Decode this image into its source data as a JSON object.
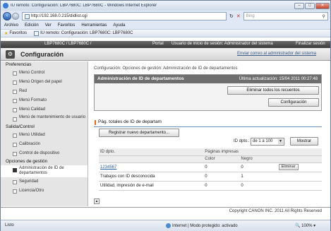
{
  "browser": {
    "title": "IU remoto: Configuración: LBP7680C: LBP7680C - Windows Internet Explorer",
    "address": "http://192.168.0.215/didlist.cgi",
    "search_placeholder": "Bing",
    "menu": [
      "Archivo",
      "Edición",
      "Ver",
      "Favoritos",
      "Herramientas",
      "Ayuda"
    ],
    "favorites_label": "Favoritos",
    "tab_title": "IU remoto: Configuración: LBP7680C: LBP7680C",
    "status_text": "Listo",
    "zone_text": "Internet | Modo protegido: activado",
    "zoom": "100%"
  },
  "header": {
    "model": "LBP7680C / LBP7680C /",
    "portal": "Portal",
    "user": "Usuario de inicio de sesión: Administrador del sistema",
    "logout": "Finalizar sesión",
    "page_title": "Configuración",
    "mail_link": "Enviar correo al administrador del sistema"
  },
  "sidebar": {
    "sections": [
      {
        "title": "Preferencias",
        "items": [
          "Menú Control",
          "Menú Origen del papel",
          "Red",
          "Menú Formato",
          "Menú Calidad",
          "Menú de mantenimiento de usuario"
        ]
      },
      {
        "title": "Salida/Control",
        "items": [
          "Menú Utilidad",
          "Calibración",
          "Control de dispositivo"
        ]
      },
      {
        "title": "Opciones de gestión",
        "items": [
          "Administración de ID de departamentos",
          "Seguridad",
          "Licencia/Otro"
        ]
      }
    ]
  },
  "main": {
    "breadcrumb": "Configuración: Opciones de gestión: Administración de ID de departamentos",
    "panel_title": "Administración de ID de departamentos",
    "last_update": "Última actualización: 15/04 2011 00:27:48",
    "btn_clear_all": "Eliminar todos los recuentos",
    "btn_config": "Configuración",
    "subtitle": "Pág. totales de ID de departam",
    "btn_register": "Registrar nuevo departamento...",
    "id_label": "ID dpto.:",
    "select_value": "de 1 a 100",
    "btn_show": "Mostrar",
    "table": {
      "col_id": "ID dpto.",
      "col_pages": "Páginas impresas",
      "col_color": "Color",
      "col_black": "Negro",
      "rows": [
        {
          "id": "1234567",
          "color": "0",
          "black": "0",
          "action": "Eliminar"
        },
        {
          "id": "Trabajos con ID desconocida",
          "color": "0",
          "black": "1",
          "action": ""
        },
        {
          "id": "Utilidad, impresión de e-mail",
          "color": "0",
          "black": "0",
          "action": ""
        }
      ]
    },
    "copyright": "Copyright CANON INC. 2011 All Rights Reserved"
  }
}
